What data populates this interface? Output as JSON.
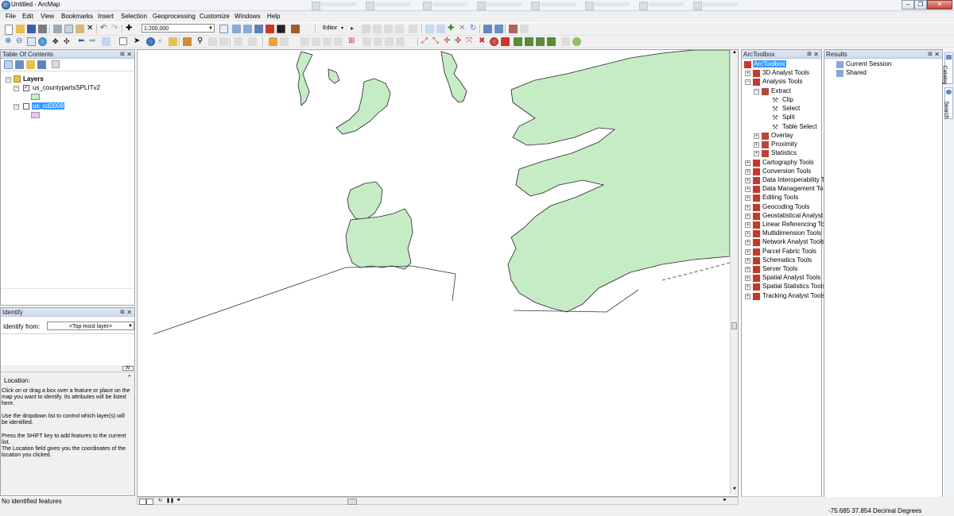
{
  "window": {
    "title": "Untitled - ArcMap"
  },
  "menu": [
    "File",
    "Edit",
    "View",
    "Bookmarks",
    "Insert",
    "Selection",
    "Geoprocessing",
    "Customize",
    "Windows",
    "Help"
  ],
  "toolbar": {
    "scale": "1:200,000",
    "editor_label": "Editor"
  },
  "toc": {
    "title": "Table Of Contents",
    "root": "Layers",
    "layer1": "us_countypartsSPLITv2",
    "layer2": "us_cd2008",
    "layer1_color": "#c6ecc6",
    "layer2_color": "#e8c6f0"
  },
  "identify": {
    "title": "Identify",
    "from_label": "Identify from:",
    "from_value": "<Top-most layer>",
    "location_label": "Location:",
    "help1": "Click on or drag a box over a feature or place on the map you want to identify. Its attributes will be listed here.",
    "help2": "Use the dropdown list to control which layer(s) will be identified.",
    "help3": "Press the SHIFT key to add features to the current list.",
    "help4": "The Location field gives you the coordinates of the location you clicked.",
    "status": "No identified features"
  },
  "arctoolbox": {
    "title": "ArcToolbox",
    "root": "ArcToolbox",
    "items": {
      "t3d": "3D Analyst Tools",
      "analysis": "Analysis Tools",
      "extract": "Extract",
      "clip": "Clip",
      "select": "Select",
      "split": "Split",
      "table_select": "Table Select",
      "overlay": "Overlay",
      "proximity": "Proximity",
      "statistics": "Statistics",
      "cartography": "Cartography Tools",
      "conversion": "Conversion Tools",
      "interop": "Data Interoperability T",
      "datamgmt": "Data Management To",
      "editing": "Editing Tools",
      "geocoding": "Geocoding Tools",
      "geostat": "Geostatistical Analyst",
      "linref": "Linear Referencing Too",
      "multidim": "Multidimension Tools",
      "network": "Network Analyst Tools",
      "parcel": "Parcel Fabric Tools",
      "schematics": "Schematics Tools",
      "server": "Server Tools",
      "spatial": "Spatial Analyst Tools",
      "spatstat": "Spatial Statistics Tools",
      "tracking": "Tracking Analyst Tools"
    }
  },
  "results": {
    "title": "Results",
    "current": "Current Session",
    "shared": "Shared"
  },
  "sidetabs": {
    "catalog": "Catalog",
    "search": "Search"
  },
  "status": {
    "coords": "-75.685  37.854 Decimal Degrees"
  },
  "colors": {
    "land": "#c6ecc6",
    "toolbox_red": "#c8372d",
    "selection": "#3399ff"
  }
}
